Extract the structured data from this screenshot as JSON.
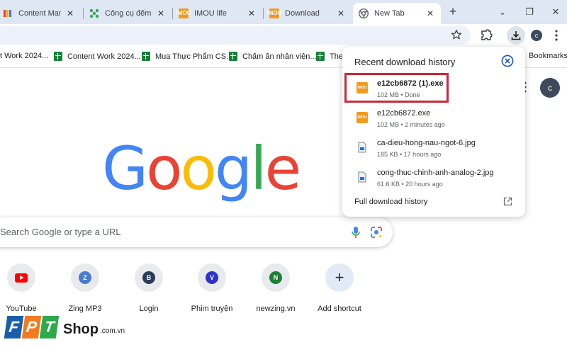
{
  "tabs": [
    {
      "title": "Content Manage",
      "icon": "app-icon",
      "close": "✕",
      "active": false
    },
    {
      "title": "Công cụ đếm ký",
      "icon": "tool-icon",
      "close": "✕",
      "active": false
    },
    {
      "title": "IMOU life",
      "icon": "imou-icon",
      "close": "✕",
      "active": false
    },
    {
      "title": "Download",
      "icon": "imou-icon",
      "close": "✕",
      "active": false
    },
    {
      "title": "New Tab",
      "icon": "chrome-icon",
      "close": "✕",
      "active": true
    }
  ],
  "toolbar": {
    "new_tab": "+",
    "minimize": "⌄",
    "restore": "❐",
    "close_window": "✕",
    "profile_initial": "c"
  },
  "bookmarks": [
    {
      "label": "t Work 2024..."
    },
    {
      "label": "Content Work 2024..."
    },
    {
      "label": "Mua Thực Phẩm CS..."
    },
    {
      "label": "Chấm ăn nhân viên..."
    },
    {
      "label": "The"
    }
  ],
  "bookmarks_folder": "Bookmarks",
  "google": {
    "letters": [
      {
        "ch": "G",
        "color": "#4285F4"
      },
      {
        "ch": "o",
        "color": "#EA4335"
      },
      {
        "ch": "o",
        "color": "#FBBC05"
      },
      {
        "ch": "g",
        "color": "#4285F4"
      },
      {
        "ch": "l",
        "color": "#34A853"
      },
      {
        "ch": "e",
        "color": "#EA4335"
      }
    ],
    "search_placeholder": "Search Google or type a URL",
    "avatar_initial": "c"
  },
  "shortcuts": [
    {
      "label": "YouTube",
      "initial": "",
      "color": "#ff0000"
    },
    {
      "label": "Zing MP3",
      "initial": "Z",
      "color": "#4a7bd0"
    },
    {
      "label": "Login",
      "initial": "B",
      "color": "#2b3a5a"
    },
    {
      "label": "Phim truyện",
      "initial": "V",
      "color": "#2d33c9"
    },
    {
      "label": "newzing.vn",
      "initial": "N",
      "color": "#1e7e34"
    },
    {
      "label": "Add shortcut",
      "initial": "+",
      "color": ""
    }
  ],
  "download_panel": {
    "title": "Recent download history",
    "items": [
      {
        "name": "e12cb6872 (1).exe",
        "meta": "102 MB • Done",
        "type": "exe"
      },
      {
        "name": "e12cb6872.exe",
        "meta": "102 MB • 2 minutes ago",
        "type": "exe"
      },
      {
        "name": "ca-dieu-hong-nau-ngot-6.jpg",
        "meta": "185 KB • 17 hours ago",
        "type": "jpg"
      },
      {
        "name": "cong-thuc-chinh-anh-analog-2.jpg",
        "meta": "61.6 KB • 20 hours ago",
        "type": "jpg"
      }
    ],
    "full_history": "Full download history",
    "imou_text": "IMOU"
  },
  "watermark": {
    "letters": [
      {
        "ch": "F",
        "color": "#1a5eab"
      },
      {
        "ch": "P",
        "color": "#f27b1f"
      },
      {
        "ch": "T",
        "color": "#2eaa4a"
      }
    ],
    "shop": "Shop",
    "domain": ".com.vn"
  },
  "colors": {
    "tab_strip": "#dfe7f4",
    "highlight": "#c8283a",
    "accent": "#1a73e8"
  }
}
